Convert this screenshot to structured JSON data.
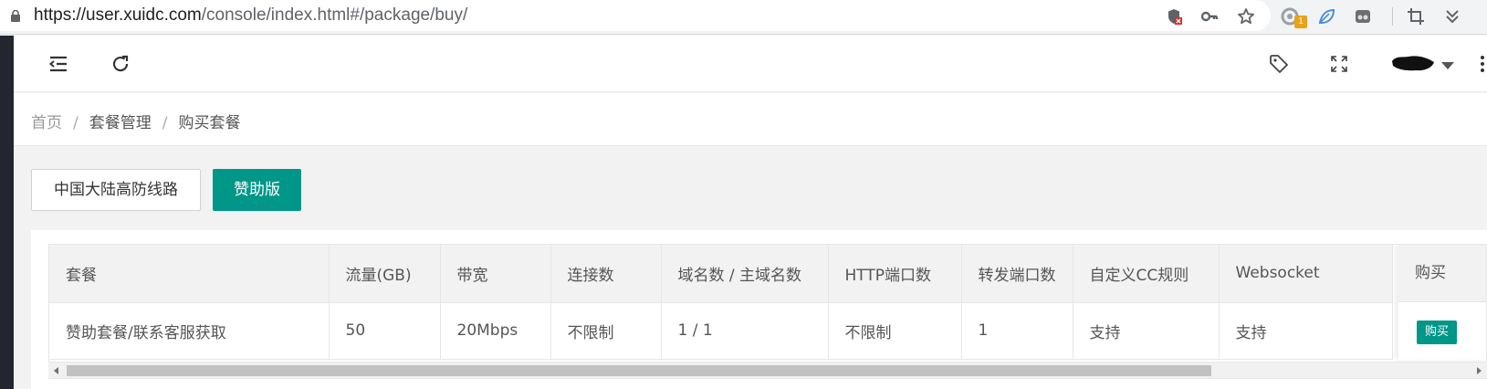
{
  "browser": {
    "url_host": "https://user.xuidc.com",
    "url_path": "/console/index.html#/package/buy/",
    "extension_badge": "1"
  },
  "header": {
    "icons": [
      "menu-fold-icon",
      "refresh-icon",
      "tag-icon",
      "fullscreen-icon",
      "user-caret-icon",
      "more-icon"
    ]
  },
  "breadcrumb": {
    "items": [
      "首页",
      "套餐管理",
      "购买套餐"
    ],
    "separator": "/"
  },
  "tabs": {
    "plain_label": "中国大陆高防线路",
    "primary_label": "赞助版"
  },
  "table": {
    "columns": [
      "套餐",
      "流量(GB)",
      "带宽",
      "连接数",
      "域名数 / 主域名数",
      "HTTP端口数",
      "转发端口数",
      "自定义CC规则",
      "Websocket",
      "购买"
    ],
    "rows": [
      {
        "cells": [
          "赞助套餐/联系客服获取",
          "50",
          "20Mbps",
          "不限制",
          "1 / 1",
          "不限制",
          "1",
          "支持",
          "支持"
        ],
        "buy_label": "购买"
      }
    ]
  },
  "colors": {
    "primary": "#009688",
    "sidebar": "#23262e"
  }
}
